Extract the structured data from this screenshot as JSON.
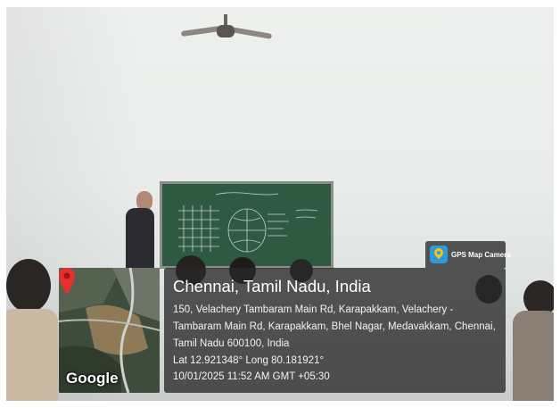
{
  "overlay": {
    "city": "Chennai, Tamil Nadu, India",
    "address": "150, Velachery Tambaram Main Rd, Karapakkam, Velachery - Tambaram Main Rd, Karapakkam, Bhel Nagar, Medavakkam, Chennai, Tamil Nadu 600100, India",
    "coordinates": "Lat 12.921348° Long 80.181921°",
    "datetime": "10/01/2025 11:52 AM GMT +05:30"
  },
  "map": {
    "logo_text": "Google",
    "pin_color": "#e5302f"
  },
  "badge": {
    "label": "GPS Map Camera",
    "icon": "gps-map-camera-icon"
  }
}
